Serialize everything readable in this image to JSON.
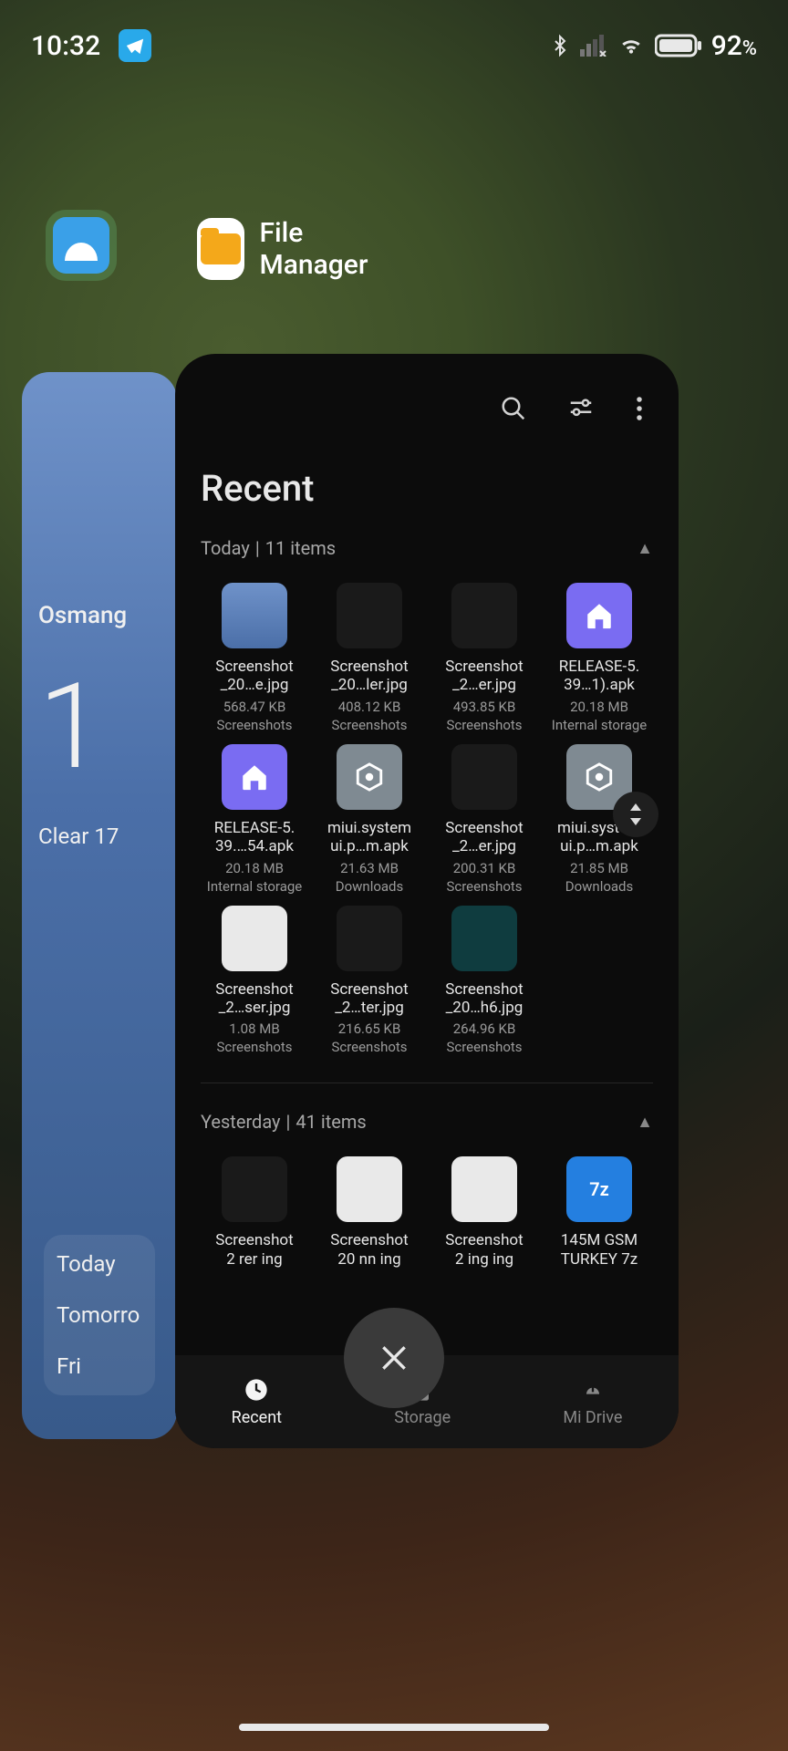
{
  "status": {
    "time": "10:32",
    "battery": "92",
    "battery_suffix": "%"
  },
  "bg_app": {
    "city": "Osmang",
    "temp": "1",
    "condition": "Clear  17",
    "forecast": [
      "Today",
      "Tomorro",
      "Fri"
    ]
  },
  "fm": {
    "title": "File Manager",
    "heading": "Recent",
    "nav": {
      "recent": "Recent",
      "storage": "Storage",
      "midrive": "Mi Drive"
    },
    "sections": [
      {
        "label": "Today",
        "count": "11 items"
      },
      {
        "label": "Yesterday",
        "count": "41 items"
      }
    ],
    "today_files": [
      {
        "name1": "Screenshot",
        "name2": "_20…e.jpg",
        "size": "568.47 KB",
        "loc": "Screenshots",
        "thumb": "sky"
      },
      {
        "name1": "Screenshot",
        "name2": "_20…ler.jpg",
        "size": "408.12 KB",
        "loc": "Screenshots",
        "thumb": "dark"
      },
      {
        "name1": "Screenshot",
        "name2": "_2…er.jpg",
        "size": "493.85 KB",
        "loc": "Screenshots",
        "thumb": "dark"
      },
      {
        "name1": "RELEASE-5.",
        "name2": "39…1).apk",
        "size": "20.18 MB",
        "loc": "Internal storage",
        "thumb": "app"
      },
      {
        "name1": "RELEASE-5.",
        "name2": "39.…54.apk",
        "size": "20.18 MB",
        "loc": "Internal storage",
        "thumb": "app"
      },
      {
        "name1": "miui.system",
        "name2": "ui.p…m.apk",
        "size": "21.63 MB",
        "loc": "Downloads",
        "thumb": "sys"
      },
      {
        "name1": "Screenshot",
        "name2": "_2…er.jpg",
        "size": "200.31 KB",
        "loc": "Screenshots",
        "thumb": "dark"
      },
      {
        "name1": "miui.system",
        "name2": "ui.p…m.apk",
        "size": "21.85 MB",
        "loc": "Downloads",
        "thumb": "sys"
      },
      {
        "name1": "Screenshot",
        "name2": "_2…ser.jpg",
        "size": "1.08 MB",
        "loc": "Screenshots",
        "thumb": "doc"
      },
      {
        "name1": "Screenshot",
        "name2": "_2…ter.jpg",
        "size": "216.65 KB",
        "loc": "Screenshots",
        "thumb": "dark"
      },
      {
        "name1": "Screenshot",
        "name2": "_20…h6.jpg",
        "size": "264.96 KB",
        "loc": "Screenshots",
        "thumb": "teal"
      }
    ],
    "yesterday_files": [
      {
        "name1": "Screenshot",
        "name2": "2  rer ing",
        "thumb": "dark"
      },
      {
        "name1": "Screenshot",
        "name2": "20  nn ing",
        "thumb": "doc"
      },
      {
        "name1": "Screenshot",
        "name2": "2  ing ing",
        "thumb": "doc"
      },
      {
        "name1": "145M GSM",
        "name2": "TURKEY 7z",
        "thumb": "sev",
        "badge": "7z"
      }
    ]
  }
}
